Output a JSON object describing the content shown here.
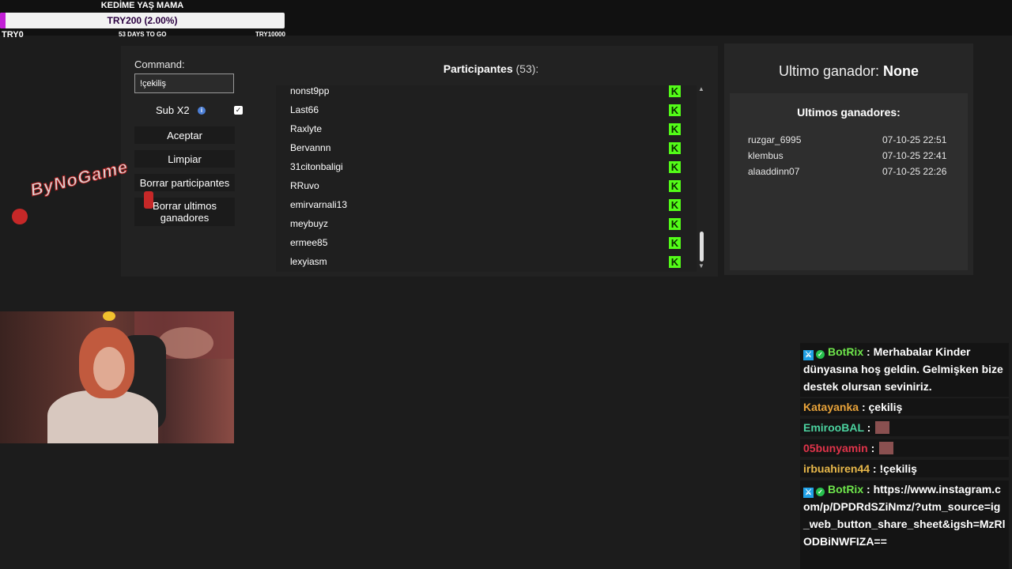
{
  "goal": {
    "title": "KEDİME YAŞ MAMA",
    "amount": "TRY200 (2.00%)",
    "progress_percent": 2.0,
    "start": "TRY0",
    "days_left": "53 DAYS TO GO",
    "target": "TRY10000",
    "fill_color": "#c21fd6"
  },
  "giveaway": {
    "command_label": "Command:",
    "command_value": "!çekiliş",
    "sub_label": "Sub X2",
    "sub_checked": true,
    "buttons": {
      "accept": "Aceptar",
      "clear": "Limpiar",
      "clear_participants": "Borrar participantes",
      "clear_winners_line1": "Borrar ultimos",
      "clear_winners_line2": "ganadores"
    },
    "participants_title": "Participantes",
    "participants_count": "(53):",
    "participants": [
      "nonst9pp",
      "Last66",
      "Raxlyte",
      "Bervannn",
      "31citonbaligi",
      "RRuvo",
      "emirvarnali13",
      "meybuyz",
      "ermee85",
      "lexyiasm"
    ]
  },
  "winners": {
    "last_winner_label": "Ultimo ganador:",
    "last_winner_value": "None",
    "list_title": "Ultimos ganadores:",
    "list": [
      {
        "name": "ruzgar_6995",
        "date": "07-10-25 22:51"
      },
      {
        "name": "klembus",
        "date": "07-10-25 22:41"
      },
      {
        "name": "alaaddinn07",
        "date": "07-10-25 22:26"
      }
    ]
  },
  "logo": {
    "text": "ByNoGame"
  },
  "chat": {
    "messages": [
      {
        "user": "BotRix",
        "text": "Merhabalar Kinder dünyasına hoş geldin. Gelmişken bize destek olursan seviniriz."
      },
      {
        "user": "Katayanka",
        "text": "çekiliş"
      },
      {
        "user": "EmirooBAL",
        "text": ""
      },
      {
        "user": "05bunyamin",
        "text": ""
      },
      {
        "user": "irbuahiren44",
        "text": "!çekiliş"
      },
      {
        "user": "BotRix",
        "text": "https://www.instagram.com/p/DPDRdSZiNmz/?utm_source=ig_web_button_share_sheet&igsh=MzRlODBiNWFIZA=="
      }
    ],
    "separator": ":"
  }
}
